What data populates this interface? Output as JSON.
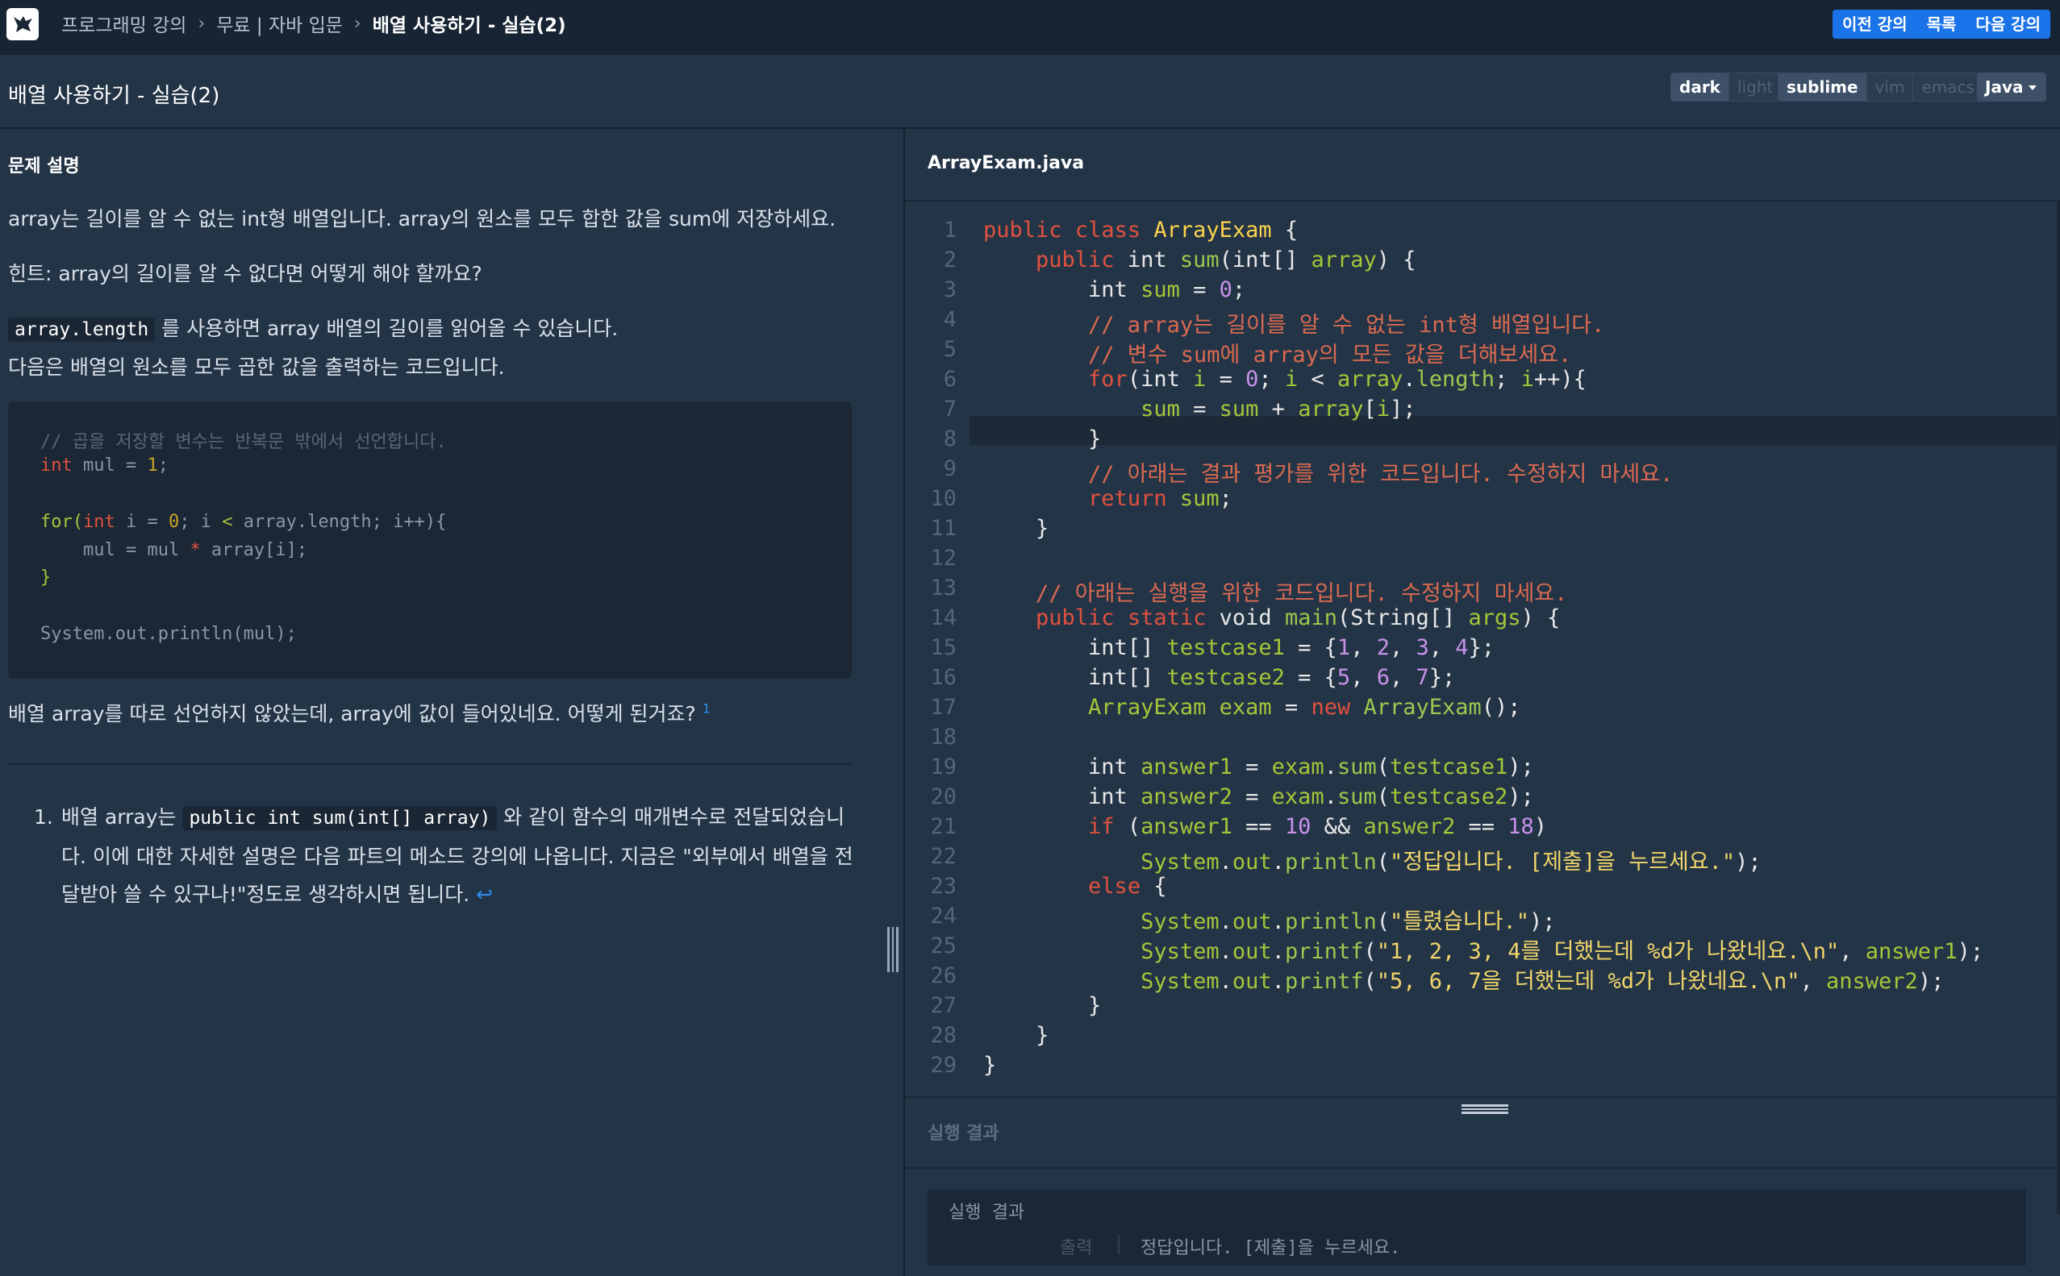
{
  "breadcrumbs": [
    "프로그래밍 강의",
    "무료 | 자바 입문",
    "배열 사용하기 - 실습(2)"
  ],
  "nav": {
    "prev": "이전 강의",
    "list": "목록",
    "next": "다음 강의"
  },
  "lesson_title": "배열 사용하기 - 실습(2)",
  "theme": {
    "dark": "dark",
    "light": "light",
    "selected": "dark"
  },
  "keymap": {
    "sublime": "sublime",
    "vim": "vim",
    "emacs": "emacs",
    "selected": "sublime"
  },
  "language": "Java",
  "problem": {
    "title": "문제 설명",
    "p1": "array는 길이를 알 수 없는 int형 배열입니다. array의 원소를 모두 합한 값을 sum에 저장하세요.",
    "p2": "힌트: array의 길이를 알 수 없다면 어떻게 해야 할까요?",
    "p3_code": "array.length",
    "p3_text": " 를 사용하면 array 배열의 길이를 읽어올 수 있습니다.",
    "p4": "다음은 배열의 원소를 모두 곱한 값을 출력하는 코드입니다.",
    "example_code": [
      "// 곱을 저장할 변수는 반복문 밖에서 선언합니다.",
      "int mul = 1;",
      "",
      "for(int i = 0; i < array.length; i++){",
      "    mul = mul * array[i];",
      "}",
      "",
      "System.out.println(mul);"
    ],
    "p5": "배열 array를 따로 선언하지 않았는데, array에 값이 들어있네요. 어떻게 된거죠?",
    "p5_sup": "1",
    "footnote_num": "1.",
    "footnote_pre": "배열 array는 ",
    "footnote_code": "public int sum(int[] array)",
    "footnote_post": " 와 같이 함수의 매개변수로 전달되었습니다. 이에 대한 자세한 설명은 다음 파트의 메소드 강의에 나옵니다. 지금은 \"외부에서 배열을 전달받아 쓸 수 있구나!\"정도로 생각하시면 됩니다.",
    "footnote_back": "↩"
  },
  "editor": {
    "filename": "ArrayExam.java",
    "line_numbers": [
      "1",
      "2",
      "3",
      "4",
      "5",
      "6",
      "7",
      "8",
      "9",
      "10",
      "11",
      "12",
      "13",
      "14",
      "15",
      "16",
      "17",
      "18",
      "19",
      "20",
      "21",
      "22",
      "23",
      "24",
      "25",
      "26",
      "27",
      "28",
      "29"
    ],
    "active_line": 7,
    "lines": [
      "public class ArrayExam {",
      "    public int sum(int[] array) {",
      "        int sum = 0;",
      "        // array는 길이를 알 수 없는 int형 배열입니다.",
      "        // 변수 sum에 array의 모든 값을 더해보세요.",
      "        for(int i = 0; i < array.length; i++){",
      "            sum = sum + array[i];",
      "        }",
      "        // 아래는 결과 평가를 위한 코드입니다. 수정하지 마세요.",
      "        return sum;",
      "    }",
      "",
      "    // 아래는 실행을 위한 코드입니다. 수정하지 마세요.",
      "    public static void main(String[] args) {",
      "        int[] testcase1 = {1, 2, 3, 4};",
      "        int[] testcase2 = {5, 6, 7};",
      "        ArrayExam exam = new ArrayExam();",
      "",
      "        int answer1 = exam.sum(testcase1);",
      "        int answer2 = exam.sum(testcase2);",
      "        if (answer1 == 10 && answer2 == 18)",
      "            System.out.println(\"정답입니다. [제출]을 누르세요.\");",
      "        else {",
      "            System.out.println(\"틀렸습니다.\");",
      "            System.out.printf(\"1, 2, 3, 4를 더했는데 %d가 나왔네요.\\n\", answer1);",
      "            System.out.printf(\"5, 6, 7을 더했는데 %d가 나왔네요.\\n\", answer2);",
      "        }",
      "    }",
      "}"
    ]
  },
  "result": {
    "section_title": "실행 결과",
    "box_label": "실행 결과",
    "output_label": "출력",
    "output_value": "정답입니다. [제출]을 누르세요."
  }
}
